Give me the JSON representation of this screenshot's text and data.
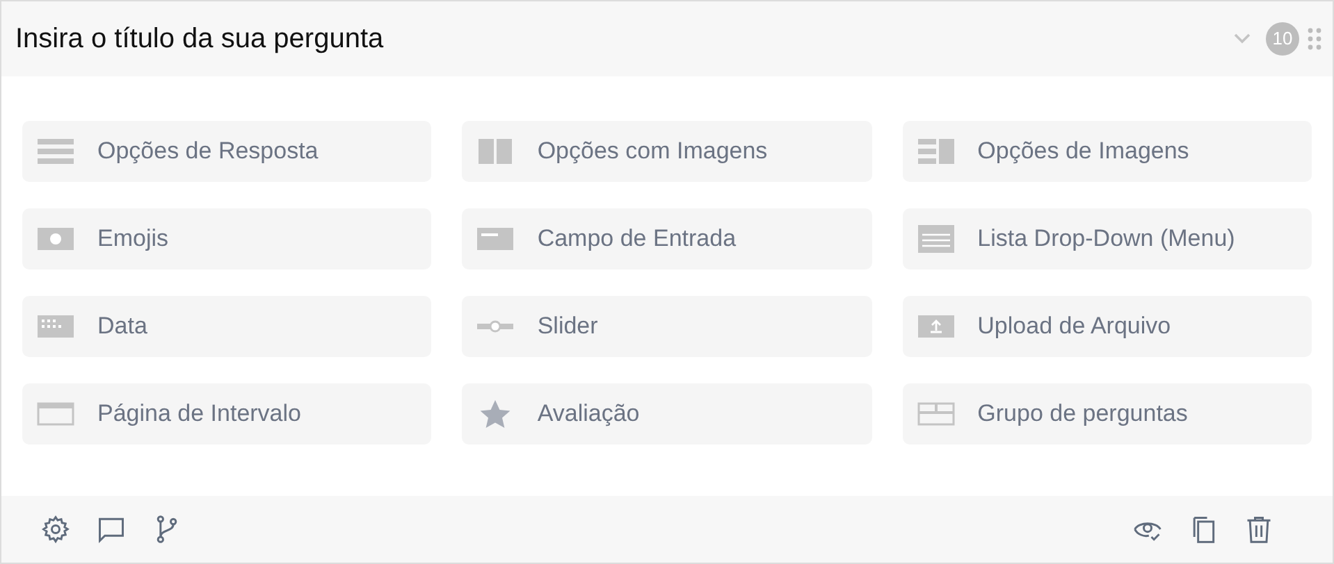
{
  "question": {
    "title": "Insira o título da sua pergunta",
    "number": "10"
  },
  "types": [
    {
      "label": "Opções de Resposta",
      "kind": "list"
    },
    {
      "label": "Opções com Imagens",
      "kind": "images"
    },
    {
      "label": "Opções de Imagens",
      "kind": "listimage"
    },
    {
      "label": "Emojis",
      "kind": "emoji"
    },
    {
      "label": "Campo de Entrada",
      "kind": "input"
    },
    {
      "label": "Lista Drop-Down (Menu)",
      "kind": "dropdown"
    },
    {
      "label": "Data",
      "kind": "date"
    },
    {
      "label": "Slider",
      "kind": "slider"
    },
    {
      "label": "Upload de Arquivo",
      "kind": "upload"
    },
    {
      "label": "Página de Intervalo",
      "kind": "break"
    },
    {
      "label": "Avaliação",
      "kind": "star"
    },
    {
      "label": "Grupo de perguntas",
      "kind": "group"
    }
  ]
}
